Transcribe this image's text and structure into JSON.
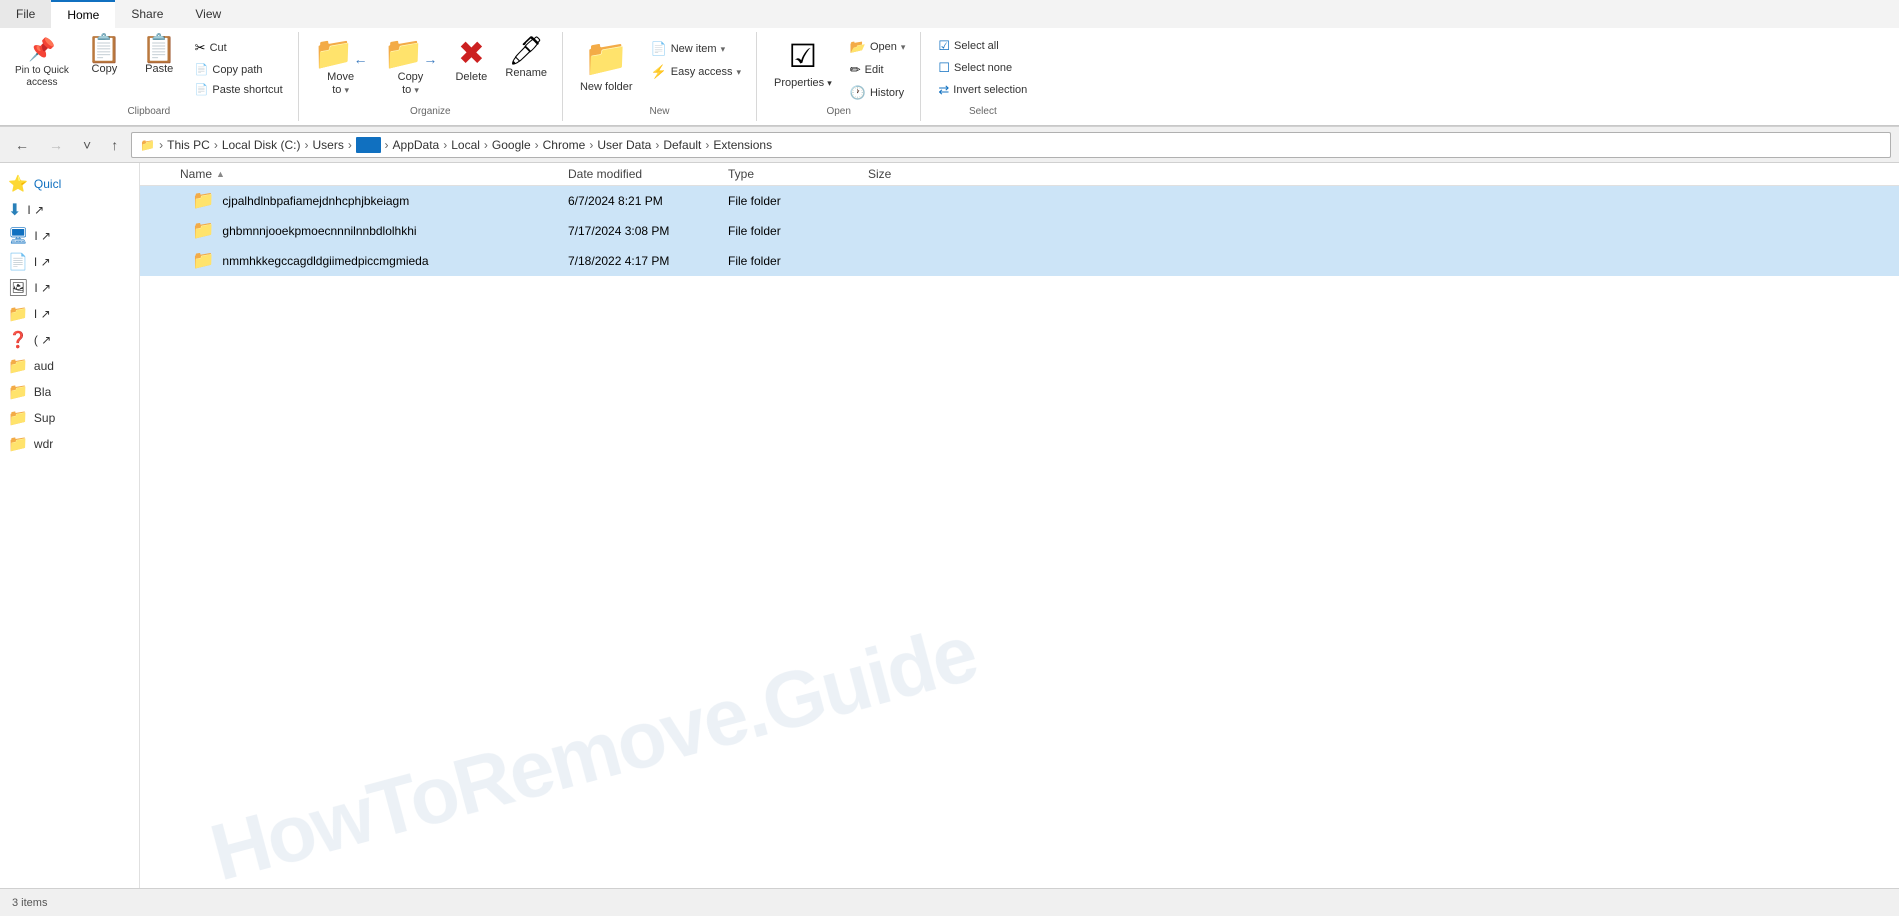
{
  "tabs": {
    "file": "File",
    "home": "Home",
    "share": "Share",
    "view": "View"
  },
  "clipboard": {
    "label": "Clipboard",
    "pin_icon": "📌",
    "pin_label": "Pin to Quick\naccess",
    "copy_icon": "📋",
    "copy_label": "Copy",
    "paste_icon": "📋",
    "paste_label": "Paste",
    "cut_icon": "✂",
    "cut_label": "Cut",
    "copy_path_icon": "📄",
    "copy_path_label": "Copy path",
    "paste_shortcut_icon": "📄",
    "paste_shortcut_label": "Paste shortcut"
  },
  "organize": {
    "label": "Organize",
    "move_to_icon": "📁",
    "move_to_label": "Move\nto",
    "copy_to_icon": "📁",
    "copy_to_label": "Copy\nto",
    "delete_icon": "✕",
    "delete_label": "Delete",
    "rename_icon": "✏",
    "rename_label": "Rename"
  },
  "new_group": {
    "label": "New",
    "new_item_icon": "📄",
    "new_item_label": "New item",
    "easy_access_icon": "⚡",
    "easy_access_label": "Easy access",
    "new_folder_icon": "📁",
    "new_folder_label": "New\nfolder"
  },
  "open_group": {
    "label": "Open",
    "properties_icon": "☑",
    "properties_label": "Properties",
    "open_icon": "📂",
    "open_label": "Open",
    "edit_icon": "✏",
    "edit_label": "Edit",
    "history_icon": "🕐",
    "history_label": "History"
  },
  "select_group": {
    "label": "Select",
    "select_all_icon": "☑",
    "select_all_label": "Select all",
    "select_none_icon": "☐",
    "select_none_label": "Select none",
    "invert_icon": "⇄",
    "invert_label": "Invert selection"
  },
  "address_bar": {
    "breadcrumb": [
      "This PC",
      "Local Disk (C:)",
      "Users",
      "",
      "AppData",
      "Local",
      "Google",
      "Chrome",
      "User Data",
      "Default",
      "Extensions"
    ],
    "highlighted_index": 3,
    "highlighted_text": "     "
  },
  "columns": {
    "name": "Name",
    "date_modified": "Date modified",
    "type": "Type",
    "size": "Size"
  },
  "files": [
    {
      "name": "cjpalhdlnbpafiamejdnhcphjbkeiagm",
      "date": "6/7/2024 8:21 PM",
      "type": "File folder",
      "size": ""
    },
    {
      "name": "ghbmnnjooekpmoecnnnilnnbdlolhkhi",
      "date": "7/17/2024 3:08 PM",
      "type": "File folder",
      "size": ""
    },
    {
      "name": "nmmhkkegccagdldgiimedpiccmgmieda",
      "date": "7/18/2022 4:17 PM",
      "type": "File folder",
      "size": ""
    }
  ],
  "sidebar": {
    "items": [
      {
        "icon": "⭐",
        "label": "Quicl",
        "pinned": true
      },
      {
        "icon": "⬇",
        "label": "I ↗",
        "pinned": false
      },
      {
        "icon": "🖥",
        "label": "I ↗",
        "pinned": false
      },
      {
        "icon": "📄",
        "label": "I ↗",
        "pinned": false
      },
      {
        "icon": "🖼",
        "label": "I ↗",
        "pinned": false
      },
      {
        "icon": "📁",
        "label": "I ↗",
        "pinned": false
      },
      {
        "icon": "❓",
        "label": "( ↗",
        "pinned": false
      },
      {
        "icon": "📁",
        "label": "aud",
        "pinned": false
      },
      {
        "icon": "📁",
        "label": "Bla",
        "pinned": false
      },
      {
        "icon": "📁",
        "label": "Sup",
        "pinned": false
      },
      {
        "icon": "📁",
        "label": "wdr",
        "pinned": false
      }
    ]
  },
  "status_bar": {
    "text": "3 items"
  },
  "watermark": "HowToRemove.Guide"
}
